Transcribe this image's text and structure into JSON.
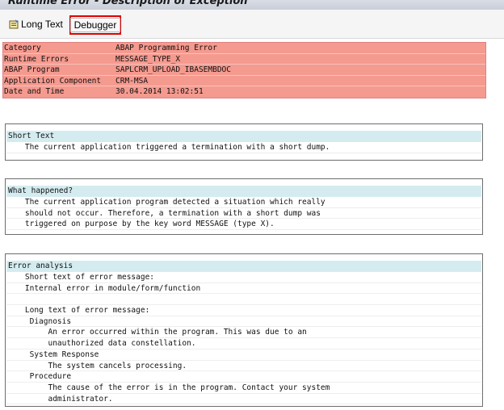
{
  "window": {
    "title": "Runtime Error - Description of Exception"
  },
  "toolbar": {
    "long_text_label": "Long Text",
    "debugger_label": "Debugger"
  },
  "info": [
    {
      "key": "Category",
      "value": "ABAP Programming Error"
    },
    {
      "key": "Runtime Errors",
      "value": "MESSAGE_TYPE_X"
    },
    {
      "key": "ABAP Program",
      "value": "SAPLCRM_UPLOAD_IBASEMBDOC"
    },
    {
      "key": "Application Component",
      "value": "CRM-MSA"
    },
    {
      "key": "Date and Time",
      "value": "30.04.2014 13:02:51"
    }
  ],
  "short_text": {
    "header": "Short Text",
    "lines": [
      "    The current application triggered a termination with a short dump."
    ]
  },
  "what_happened": {
    "header": "What happened?",
    "lines": [
      "    The current application program detected a situation which really",
      "    should not occur. Therefore, a termination with a short dump was",
      "    triggered on purpose by the key word MESSAGE (type X)."
    ]
  },
  "error_analysis": {
    "header": "Error analysis",
    "lines": [
      "    Short text of error message:",
      "    Internal error in module/form/function",
      "",
      "    Long text of error message:",
      "     Diagnosis",
      "         An error occurred within the program. This was due to an",
      "         unauthorized data constellation.",
      "     System Response",
      "         The system cancels processing.",
      "     Procedure",
      "         The cause of the error is in the program. Contact your system",
      "         administrator."
    ]
  }
}
